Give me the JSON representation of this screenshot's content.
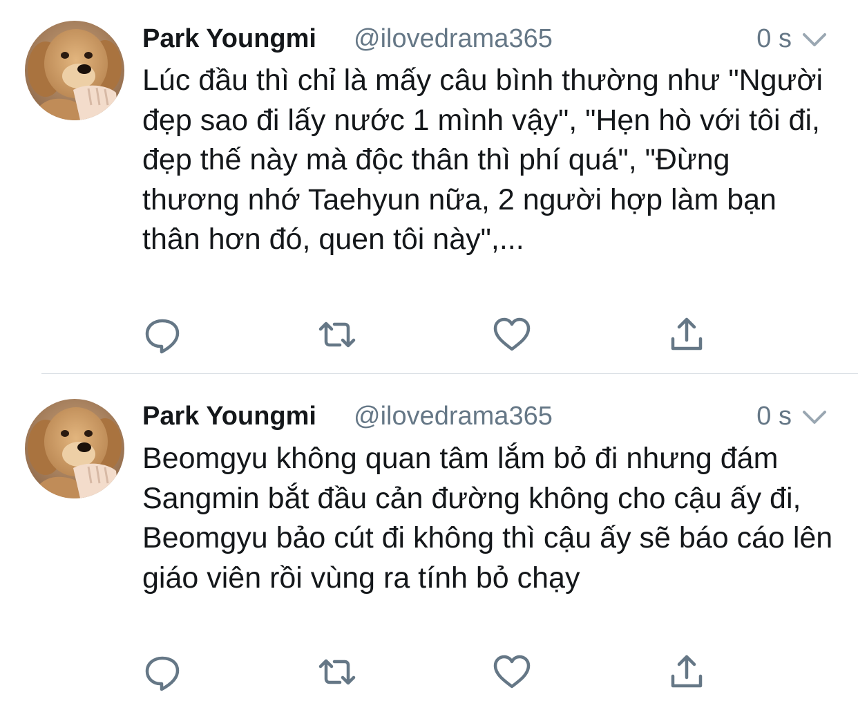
{
  "colors": {
    "text_primary": "#14171a",
    "text_secondary": "#657786",
    "icon": "#657786",
    "divider": "#d7dde2"
  },
  "tweets": [
    {
      "author_name": "Park Youngmi",
      "handle": "@ilovedrama365",
      "time": "0 s",
      "text": "Lúc đầu thì chỉ là mấy câu bình thường như \"Người đẹp sao đi lấy nước 1 mình vậy\", \"Hẹn hò với tôi đi, đẹp thế này mà độc thân thì phí quá\", \"Đừng thương nhớ Taehyun nữa, 2 người hợp làm bạn thân hơn đó, quen tôi này\",...",
      "icons": [
        "reply-icon",
        "retweet-icon",
        "like-icon",
        "share-icon"
      ]
    },
    {
      "author_name": "Park Youngmi",
      "handle": "@ilovedrama365",
      "time": "0 s",
      "text": "Beomgyu không quan tâm lắm bỏ đi nhưng đám Sangmin bắt đầu cản đường không cho cậu ấy đi, Beomgyu bảo cút đi không thì cậu ấy sẽ báo cáo lên giáo viên rồi vùng ra tính bỏ chạy",
      "icons": [
        "reply-icon",
        "retweet-icon",
        "like-icon",
        "share-icon"
      ]
    }
  ]
}
